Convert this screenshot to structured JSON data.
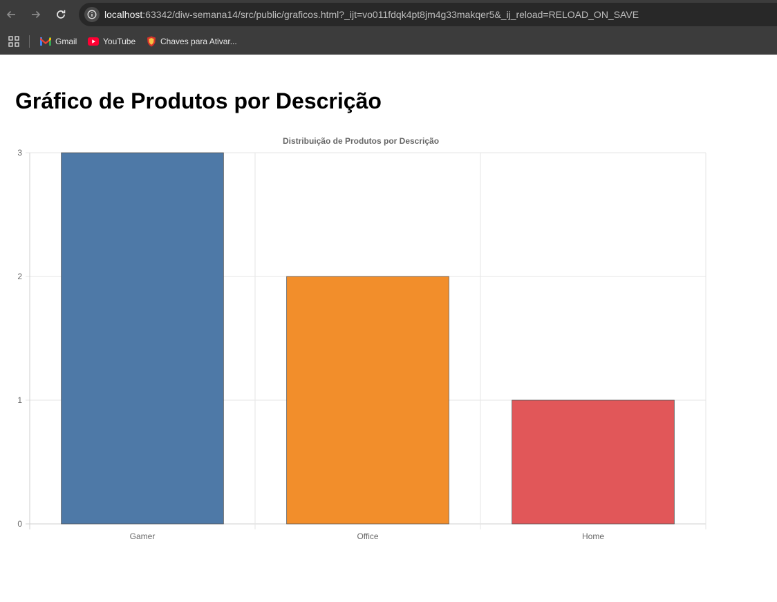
{
  "browser": {
    "url_host": "localhost",
    "url_rest": ":63342/diw-semana14/src/public/graficos.html?_ijt=vo011fdqk4pt8jm4g33makqer5&_ij_reload=RELOAD_ON_SAVE",
    "bookmarks": [
      {
        "label": "Gmail",
        "icon": "gmail-icon"
      },
      {
        "label": "YouTube",
        "icon": "youtube-icon"
      },
      {
        "label": "Chaves para Ativar...",
        "icon": "shield-icon"
      }
    ]
  },
  "page": {
    "title": "Gráfico de Produtos por Descrição"
  },
  "chart_data": {
    "type": "bar",
    "title": "Distribuição de Produtos por Descrição",
    "categories": [
      "Gamer",
      "Office",
      "Home"
    ],
    "values": [
      3,
      2,
      1
    ],
    "colors": [
      "#4e79a7",
      "#f28e2b",
      "#e15759"
    ],
    "ylim": [
      0,
      3
    ],
    "yticks": [
      0,
      1,
      2,
      3
    ],
    "xlabel": "",
    "ylabel": "",
    "grid": true,
    "legend": "none"
  }
}
